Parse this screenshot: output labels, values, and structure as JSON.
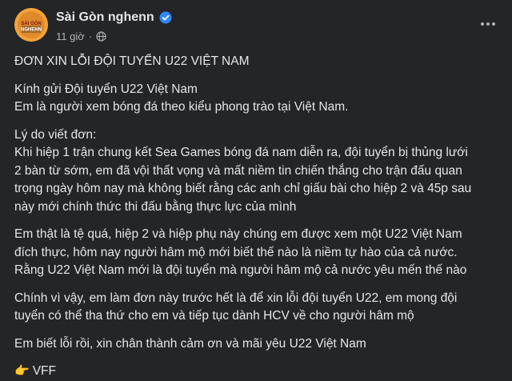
{
  "post": {
    "page_name": "Sài Gòn nghenn",
    "time": "11 giờ",
    "separator": "·",
    "avatar_text_1": "SÀI GÒN",
    "avatar_text_2": "NGHENN",
    "icons": {
      "verified": "verified-badge-icon",
      "audience": "globe-icon",
      "more": "more-options-icon",
      "pointing": "pointing-hand-icon"
    },
    "colors": {
      "background": "#242526",
      "text": "#e4e6eb",
      "secondary": "#b0b3b8",
      "verified": "#2d88ff"
    }
  },
  "content": {
    "title": "ĐƠN XIN LỖI ĐỘI TUYỂN U22 VIỆT NAM",
    "p1": [
      "Kính gửi Đội tuyển U22 Việt Nam",
      "Em là người xem bóng đá theo kiểu phong trào tại Việt Nam."
    ],
    "p2": [
      "Lý do viết đơn:",
      "Khi hiệp 1 trận chung kết Sea Games bóng đá nam diễn ra, đội tuyển bị thủng lưới",
      "2 bàn từ sớm, em đã vội thất vọng và mất niềm tin chiến thắng cho trận đấu quan",
      "trọng ngày hôm nay mà không biết rằng các anh chỉ giấu bài cho hiệp 2 và 45p sau",
      "này mới chính thức thi đấu bằng thực lực của mình"
    ],
    "p3": [
      "Em thật là tệ quá, hiệp 2 và hiệp phụ này chúng em được xem một U22 Việt Nam",
      "đích thực, hôm nay người hâm mộ mới biết thế nào là niềm tự hào của cả nước.",
      "Rằng U22 Việt Nam mới là đội tuyển mà người hâm mộ cả nước yêu mến thế nào"
    ],
    "p4": [
      "Chính vì vậy, em làm đơn này trước hết là để xin lỗi đội tuyển U22, em mong đội",
      "tuyển có thể tha thứ cho em và tiếp tục dành HCV về cho người hâm mộ"
    ],
    "p5": [
      "Em biết lỗi rồi, xin chân thành cảm ơn và mãi yêu U22 Việt Nam"
    ],
    "signature_glyph": "👉",
    "signature": "VFF"
  }
}
